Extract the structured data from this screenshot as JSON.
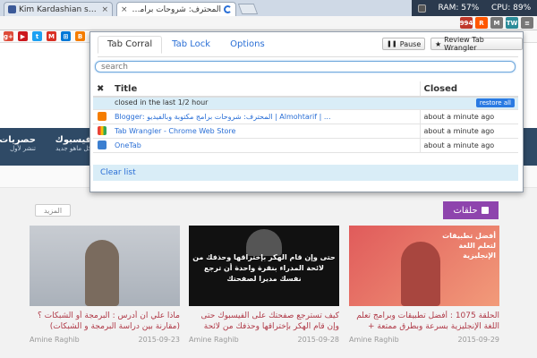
{
  "browser": {
    "tabs": [
      {
        "title": "Kim Kardashian says Kany",
        "close": "×",
        "icon_color": "#3b5998"
      },
      {
        "title": "المحترف: شروحات برامج مكتوبة",
        "close": "×",
        "icon_color": "#e67e22"
      }
    ],
    "system": {
      "ram": "RAM: 57%",
      "cpu": "CPU: 89%"
    },
    "extensions": [
      {
        "name": "ublock-icon",
        "label": "994",
        "color": "#c0392b"
      },
      {
        "name": "reddit-icon",
        "label": "R",
        "color": "#ff5700"
      },
      {
        "name": "mail-icon",
        "label": "M",
        "color": "#777777"
      },
      {
        "name": "tab-wrangler-icon",
        "label": "TW",
        "color": "#2c8c99"
      },
      {
        "name": "menu-icon",
        "label": "≡",
        "color": "#777777"
      }
    ],
    "bookmarks": [
      {
        "name": "google-plus-icon",
        "label": "g+",
        "color": "#dd4b39"
      },
      {
        "name": "youtube-icon",
        "label": "▶",
        "color": "#cc181e"
      },
      {
        "name": "twitter-icon",
        "label": "t",
        "color": "#1da1f2"
      },
      {
        "name": "gmail-icon",
        "label": "M",
        "color": "#d93025"
      },
      {
        "name": "windows-icon",
        "label": "⊞",
        "color": "#0078d7"
      },
      {
        "name": "blogger-icon",
        "label": "B",
        "color": "#f57d00"
      },
      {
        "name": "facebook-icon",
        "label": "f",
        "color": "#3b5998"
      }
    ]
  },
  "site": {
    "nav": [
      {
        "label": "حصريات",
        "sub": "تنشر لأول"
      },
      {
        "label": "فيسبوك",
        "sub": "كل ماهو جديد"
      }
    ],
    "section": {
      "title": "حلقات",
      "more": "المزيد"
    },
    "cards": [
      {
        "title": "الحلقة 1075 : أفضل تطبيقات وبرامج تعلم اللغة الإنجليزية بسرعة وبطرق ممتعة + نصائح",
        "author": "Amine Raghib",
        "date": "2015-09-29"
      },
      {
        "title": "كيف تسترجع صفحتك على الفيسبوك حتى وإن قام الهكر بإختراقها وحذفك من لائحة المدراء",
        "author": "Amine Raghib",
        "date": "2015-09-28"
      },
      {
        "title": "ماذا علي ان أدرس : البرمجة أو الشبكات ؟ (مقارنة بين دراسة البرمجة و الشبكات)",
        "author": "Amine Raghib",
        "date": "2015-09-23"
      }
    ],
    "card_overlay": {
      "card1": "أفضل تطبيقات لتعلم اللغة الإنجليزية",
      "card2": "حتى وإن قام الهكر بإختراقها وحذفك من لائحة المدراء بنقرة واحدة أن ترجع نفسك مديرا لصفحتك"
    }
  },
  "popup": {
    "tabs": [
      {
        "label": "Tab Corral",
        "active": true
      },
      {
        "label": "Tab Lock",
        "active": false
      },
      {
        "label": "Options",
        "active": false
      }
    ],
    "pause_label": "Pause",
    "review_label": "Review Tab Wrangler",
    "search_placeholder": "search",
    "columns": {
      "close_mark": "✖",
      "title": "Title",
      "closed": "Closed"
    },
    "group_label": "closed in the last 1/2 hour",
    "restore_label": "restore all",
    "rows": [
      {
        "icon": "blogger-icon",
        "color": "#f57d00",
        "title": "Blogger: المحترف: شروحات برامج مكتوبة وبالفيديو | Almohtarif | ...",
        "closed": "about a minute ago"
      },
      {
        "icon": "chrome-web-store-icon",
        "color": "#4285f4",
        "title": "Tab Wrangler - Chrome Web Store",
        "closed": "about a minute ago"
      },
      {
        "icon": "onetab-icon",
        "color": "#3c7fd0",
        "title": "OneTab",
        "closed": "about a minute ago"
      }
    ],
    "clear_label": "Clear list"
  }
}
